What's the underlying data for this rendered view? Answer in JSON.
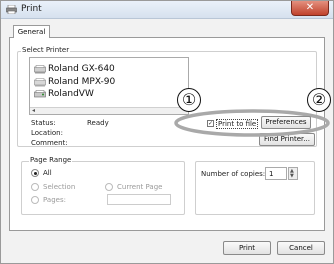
{
  "window": {
    "title": "Print",
    "close_label": "✕"
  },
  "tabs": [
    {
      "label": "General"
    }
  ],
  "select_printer": {
    "group_label": "Select Printer",
    "printers": [
      {
        "name": "Roland GX-640",
        "selected": false
      },
      {
        "name": "Roland MPX-90",
        "selected": false
      },
      {
        "name": "RolandVW",
        "selected": true
      }
    ],
    "scroll_arrow": "◂"
  },
  "status_info": {
    "status_label": "Status:",
    "status_value": "Ready",
    "location_label": "Location:",
    "comment_label": "Comment:"
  },
  "print_to_file": {
    "label": "Print to file",
    "checked": true
  },
  "buttons": {
    "preferences": "Preferences",
    "find_printer": "Find Printer...",
    "print": "Print",
    "cancel": "Cancel"
  },
  "page_range": {
    "group_label": "Page Range",
    "all_label": "All",
    "selection_label": "Selection",
    "current_page_label": "Current Page",
    "pages_label": "Pages:",
    "selected": "All"
  },
  "copies": {
    "label": "Number of copies:",
    "value": "1"
  },
  "callouts": {
    "one": "①",
    "two": "②"
  },
  "colors": {
    "callout_ellipse": "#a9a9a9",
    "close_button": "#c0422c"
  }
}
